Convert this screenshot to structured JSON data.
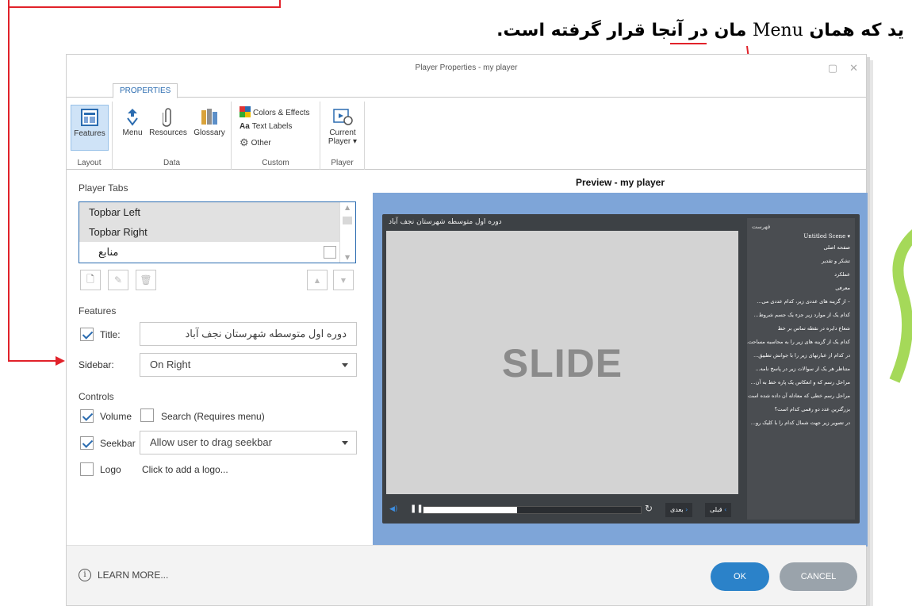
{
  "annotation": {
    "text_before": "ید که همان ",
    "menu_word": "Menu",
    "text_after": " مان در آنجا قرار گرفته است.",
    "color": "#e1222a"
  },
  "dialog": {
    "title": "Player Properties - my player",
    "maximize_icon": "maximize-icon",
    "close_icon": "close-icon"
  },
  "ribbon": {
    "tab": "PROPERTIES",
    "groups": {
      "layout": "Layout",
      "data": "Data",
      "custom": "Custom",
      "player": "Player"
    },
    "buttons": {
      "features": "Features",
      "menu": "Menu",
      "resources": "Resources",
      "glossary": "Glossary",
      "colors": "Colors & Effects",
      "text_labels": "Text Labels",
      "other": "Other",
      "current_player": "Current",
      "current_player_2": "Player ▾"
    }
  },
  "player_tabs": {
    "title": "Player Tabs",
    "items": [
      "Topbar Left",
      "Topbar Right",
      "منابع"
    ]
  },
  "features": {
    "title": "Features",
    "title_label": "Title:",
    "title_value": "دوره اول متوسطه شهرستان نجف آباد",
    "title_checked": true,
    "sidebar_label": "Sidebar:",
    "sidebar_value": "On Right"
  },
  "controls": {
    "title": "Controls",
    "volume_label": "Volume",
    "volume_checked": true,
    "search_label": "Search (Requires menu)",
    "search_checked": false,
    "seekbar_label": "Seekbar",
    "seekbar_checked": true,
    "seekbar_value": "Allow user to drag seekbar",
    "logo_label": "Logo",
    "logo_checked": false,
    "logo_link": "Click to add a logo..."
  },
  "preview": {
    "title": "Preview - my player",
    "player_title": "دوره اول متوسطه شهرستان نجف آباد",
    "slide_text": "SLIDE",
    "sidebar_heading": "فهرست",
    "scene": "Untitled Scene ▾",
    "menu_items": [
      "صفحه اصلی",
      "تشکر و تقدیر",
      "عملکرد",
      "معرفی",
      "– از گزینه های عددی زیر، کدام عددی می...",
      "کدام یک از موارد زیر جزء یک جسم شروط...",
      "شعاع دایره در نقطه تماس بر خط",
      "کدام یک از گزینه های زیر را به محاسبه مساحت...",
      "در کدام از عبارتهای زیر را با جوانش تطبیق...",
      "متناظر هر یک از سوالات زیر در پاسخ نامه...",
      "مراحل رسم که و انعکاس یک پاره خط به آن...",
      "مراحل رسم خطی که معادله آن داده شده است",
      "بزرگترین عدد دو رقمی کدام است؟",
      "در تصویر زیر جهت شمال کدام را با کلیک رو..."
    ],
    "prev_label": "قبلی",
    "next_label": "بعدی",
    "progress": 0.43,
    "bg_color": "#7ea5d8"
  },
  "footer": {
    "learn_more": "LEARN MORE...",
    "ok": "OK",
    "cancel": "CANCEL"
  }
}
